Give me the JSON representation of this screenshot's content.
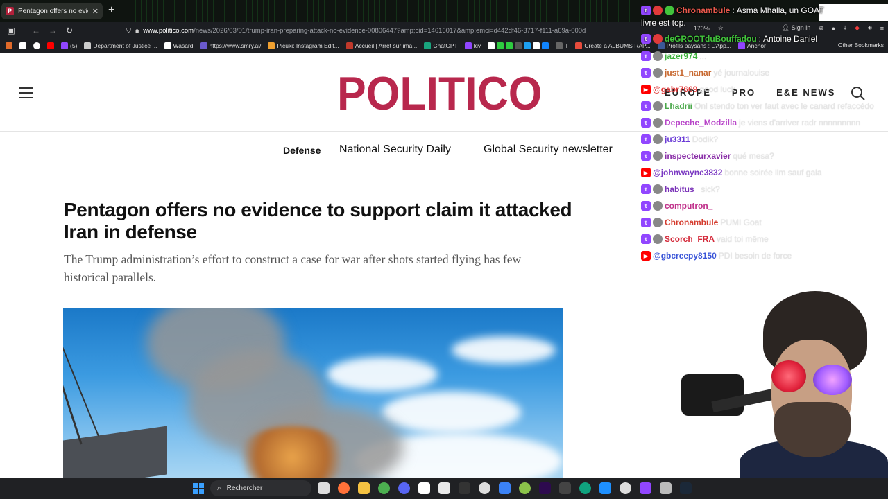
{
  "browser": {
    "tab_title": "Pentagon offers no evidence to",
    "tab_close": "✕",
    "new_tab": "+",
    "url_host": "www.politico.com",
    "url_path": "/news/2026/03/01/trump-iran-preparing-attack-no-evidence-00806447?amp;cid=14616017&amp;emci=d442df46-3717-f111-a69a-000d",
    "zoom": "170%",
    "sign_in": "Sign in",
    "bookmarks": [
      "(5)",
      "Department of Justice ...",
      "Wasard",
      "https://www.smry.ai/",
      "Picuki: Instagram Edit...",
      "Accueil | Arrêt sur ima...",
      "ChatGPT",
      "kiv",
      "T",
      "Create a ALBUMS RAP...",
      "Profils paysans : L'App...",
      "Anchor"
    ],
    "other_bookmarks": "Other Bookmarks"
  },
  "politico": {
    "logo": "POLITICO",
    "header_links": [
      "EUROPE",
      "PRO",
      "E&E NEWS"
    ],
    "subnav": [
      "Defense",
      "National Security Daily",
      "Global Security newsletter"
    ],
    "headline": "Pentagon offers no evidence to support claim it attacked Iran in defense",
    "dek": "The Trump administration’s effort to construct a case for war after shots started flying has few historical parallels."
  },
  "taskbar": {
    "search_label": "Rechercher"
  },
  "chat": {
    "top": [
      {
        "user": "Chronambule",
        "color": "#e8584b",
        "text": "Asma Mhalla, un GOAT"
      },
      {
        "user": "",
        "color": "#ffffff",
        "text": "livre est top."
      },
      {
        "user": "deGROOTduBouffadou",
        "color": "#42c43c",
        "text": "Antoine Daniel"
      }
    ],
    "messages": [
      {
        "platform": "tw",
        "user": "jazer974",
        "color": "#3db33d",
        "text": "..."
      },
      {
        "platform": "tw",
        "user": "just1_nanar",
        "color": "#c7672e",
        "text": "yé journalouise"
      },
      {
        "platform": "yt",
        "user": "@gabr7669",
        "color": "#e03a3a",
        "text": "good luck"
      },
      {
        "platform": "tw",
        "user": "Lhadrii",
        "color": "#4aa84a",
        "text": "Onl stendo ton ver faut avec le canard refaccédo"
      },
      {
        "platform": "tw",
        "user": "Depeche_Modzilla",
        "color": "#b845c9",
        "text": "je viens d'arriver radr nnnnnnnnn"
      },
      {
        "platform": "tw",
        "user": "ju3311",
        "color": "#6a3bd6",
        "text": "Dodik?"
      },
      {
        "platform": "tw",
        "user": "inspecteurxavier",
        "color": "#8a2fa8",
        "text": "qué mesa?"
      },
      {
        "platform": "yt",
        "user": "@johnwayne3832",
        "color": "#7a38c2",
        "text": "bonne soirée llm sauf gala"
      },
      {
        "platform": "tw",
        "user": "habitus_",
        "color": "#7a32b8",
        "text": "sick?"
      },
      {
        "platform": "tw",
        "user": "computron_",
        "color": "#c0308a",
        "text": ""
      },
      {
        "platform": "tw",
        "user": "Chronambule",
        "color": "#d43a2c",
        "text": "PUMI Goat"
      },
      {
        "platform": "tw",
        "user": "Scorch_FRA",
        "color": "#d42a3a",
        "text": "vaid toi même"
      },
      {
        "platform": "yt",
        "user": "@gbcreepy8150",
        "color": "#3a55d8",
        "text": "PDI besoin de force"
      }
    ]
  }
}
